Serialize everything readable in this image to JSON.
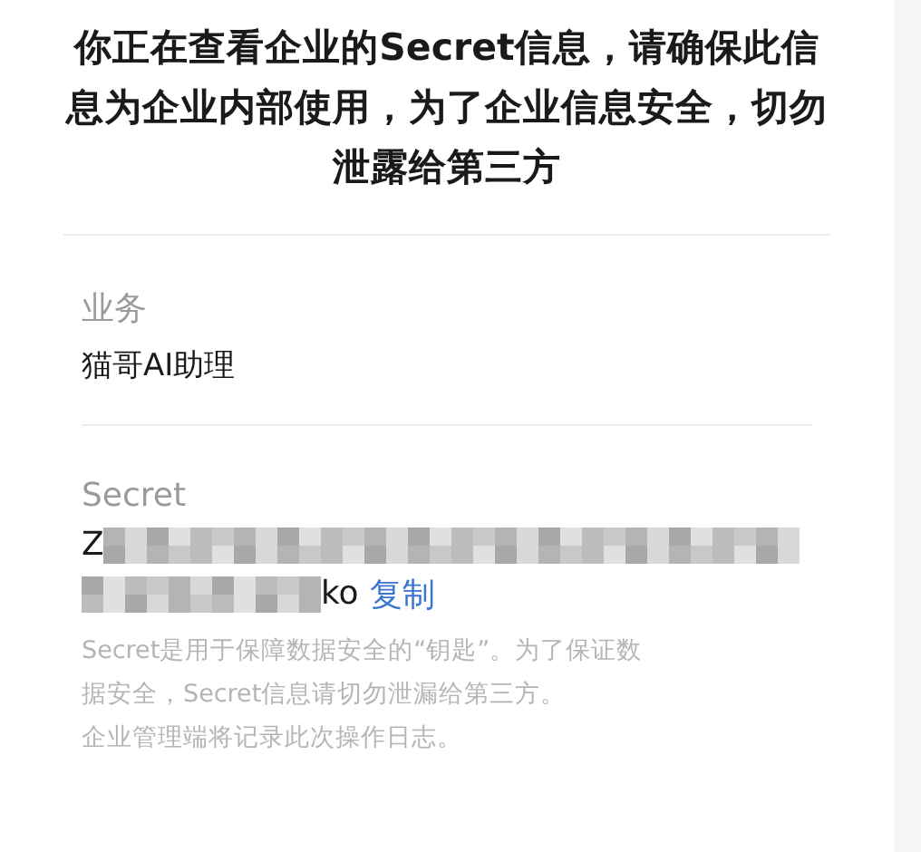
{
  "title": "你正在查看企业的Secret信息，请确保此信息为企业内部使用，为了企业信息安全，切勿泄露给第三方",
  "fields": [
    {
      "label": "业务",
      "value": "猫哥AI助理"
    }
  ],
  "secret": {
    "label": "Secret",
    "start": "Z",
    "end": "ko",
    "copy": "复制"
  },
  "note_lines": [
    "Secret是用于保障数据安全的“钥匙”。为了保证数",
    "据安全，Secret信息请切勿泄漏给第三方。",
    "企业管理端将记录此次操作日志。"
  ]
}
